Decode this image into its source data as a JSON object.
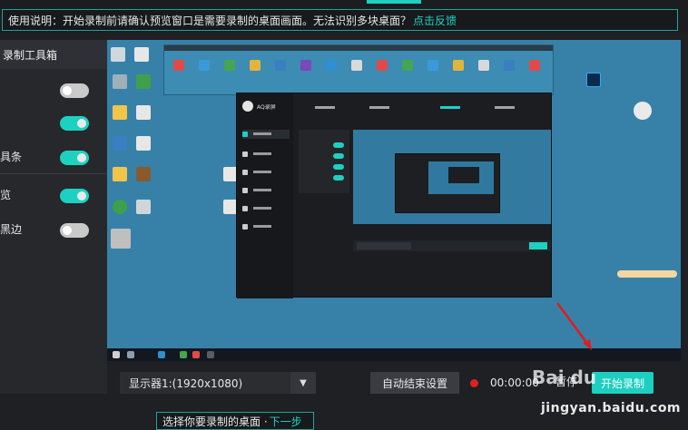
{
  "top_instruction": {
    "text": "使用说明：开始录制前请确认预览窗口是需要录制的桌面画面。无法识别多块桌面？",
    "link": "点击反馈"
  },
  "sidebar": {
    "title": "录制工具箱",
    "rows": [
      {
        "label": "",
        "toggle": "off"
      },
      {
        "label": "",
        "toggle": "on"
      },
      {
        "label": "具条",
        "toggle": "on"
      },
      {
        "label": "览",
        "toggle": "on"
      },
      {
        "label": "黑边",
        "toggle": "off"
      }
    ]
  },
  "preview": {
    "nested_app_name": "AQ录屏"
  },
  "controls": {
    "display_select": "显示器1:(1920x1080)",
    "auto_end_button": "自动结束设置",
    "timer": "00:00:00",
    "pause_button": "暂停",
    "start_button": "开始录制"
  },
  "bottom_tip": {
    "text": "选择你要录制的桌面 ·",
    "link": "下一步"
  },
  "watermark": {
    "logo_text": "Bai du",
    "site_text": "jingyan.baidu.com"
  },
  "colors": {
    "accent": "#1dd1c1",
    "record_red": "#e0211f",
    "desktop_blue": "#3781a8",
    "background": "#1e2024"
  }
}
